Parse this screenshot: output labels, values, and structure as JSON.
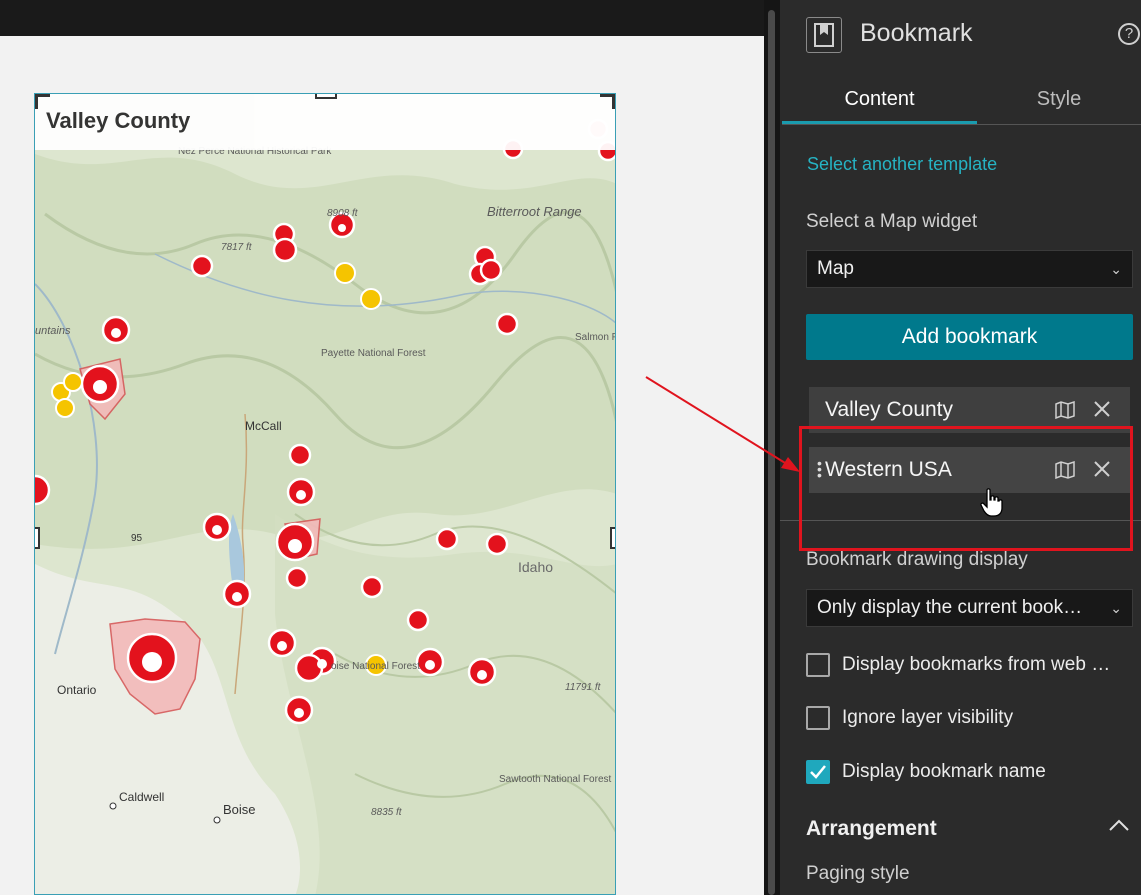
{
  "map": {
    "title": "Valley County",
    "labels": {
      "nez_perce": "Nez Perce National Historical Park",
      "bitterroot": "Bitterroot Range",
      "elev1": "8908 ft",
      "elev2": "7817 ft",
      "payette": "Payette National Forest",
      "salmon": "Salmon Fo",
      "mountains": "untains",
      "mccall": "McCall",
      "hwy": "95",
      "idaho": "Idaho",
      "ontario": "Ontario",
      "boise_nf": "oise National Forest",
      "elev3": "11791 ft",
      "sawtooth": "Sawtooth National Forest",
      "caldwell": "Caldwell",
      "boise": "Boise",
      "elev4": "8835 ft"
    },
    "colors": {
      "fire_red": "#e3121d",
      "fire_yellow": "#f5c400",
      "terrain": "#dfe7d2"
    }
  },
  "panel": {
    "title": "Bookmark",
    "help": "?",
    "tabs": {
      "content": "Content",
      "style": "Style"
    },
    "select_template": "Select another template",
    "map_widget_label": "Select a Map widget",
    "map_widget_value": "Map",
    "add_bookmark": "Add bookmark",
    "bookmarks": [
      {
        "name": "Valley County"
      },
      {
        "name": "Western USA"
      }
    ],
    "drawing_label": "Bookmark drawing display",
    "drawing_value": "Only display the current book…",
    "checkboxes": [
      {
        "label": "Display bookmarks from web …",
        "checked": false
      },
      {
        "label": "Ignore layer visibility",
        "checked": false
      },
      {
        "label": "Display bookmark name",
        "checked": true
      }
    ],
    "arrangement": "Arrangement",
    "paging_style": "Paging style",
    "accent": "#00798c",
    "highlight": "#e0141e"
  }
}
